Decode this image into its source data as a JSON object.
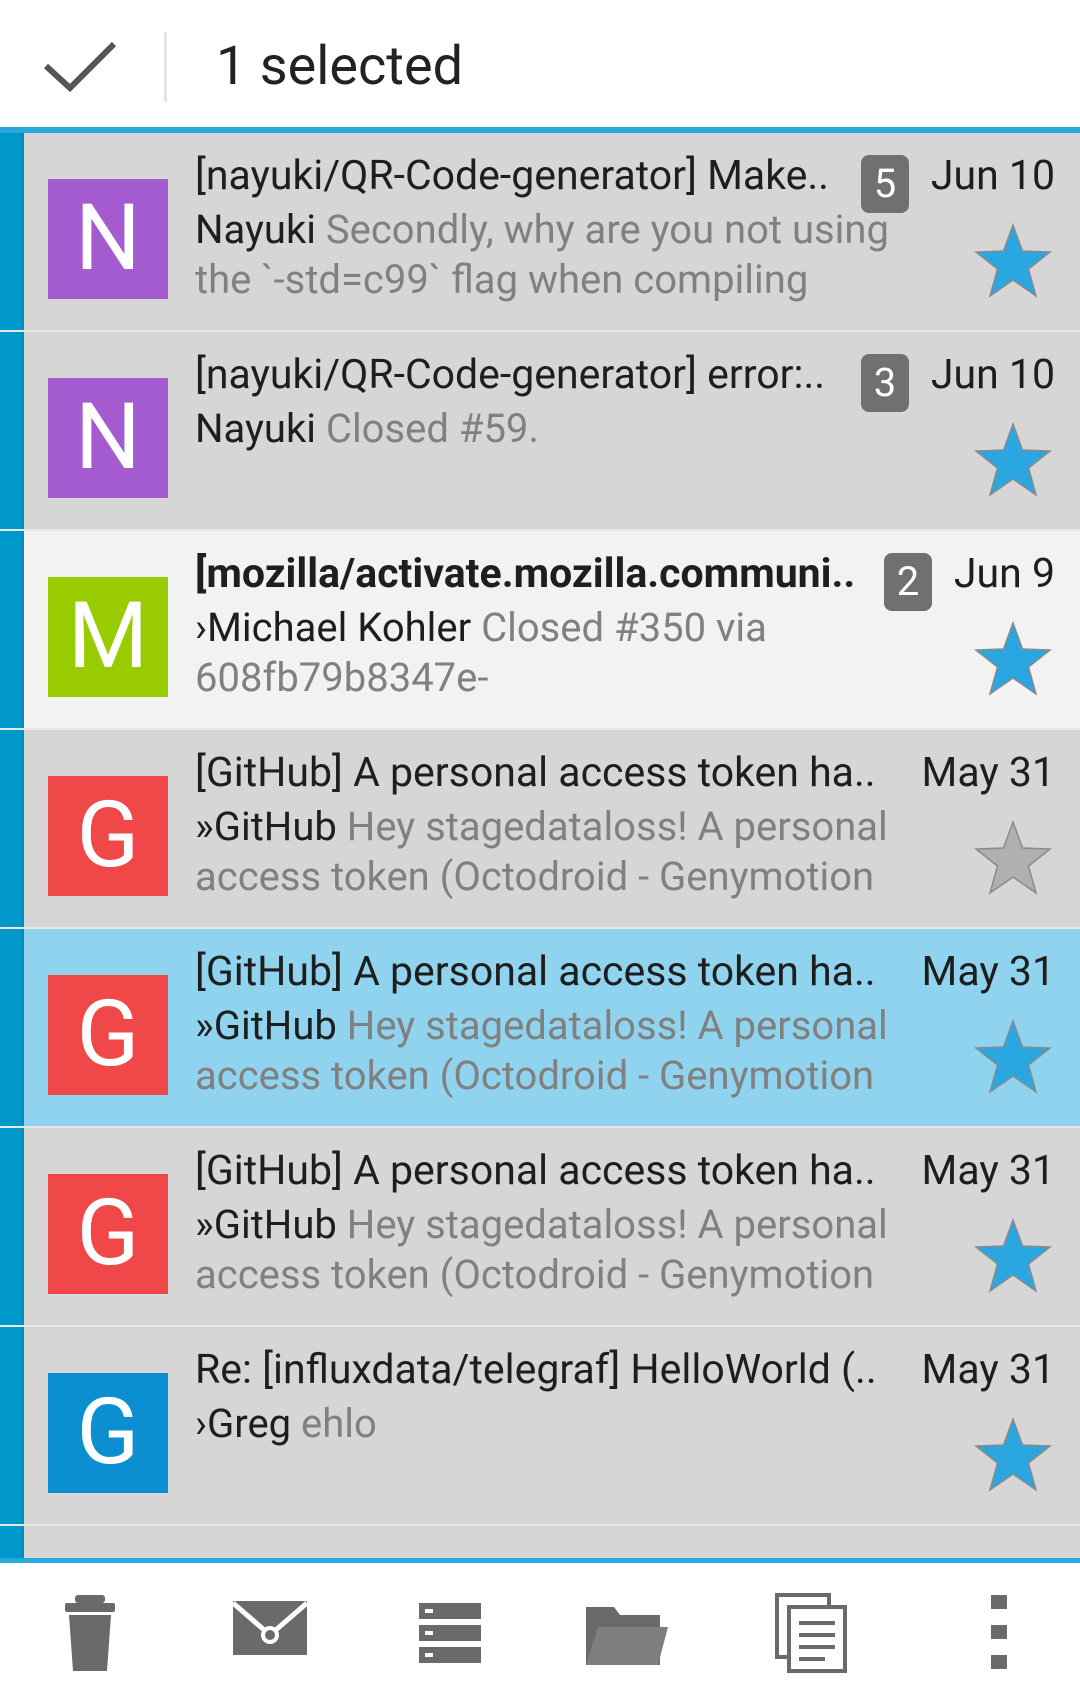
{
  "actionbar": {
    "selection_title": "1 selected",
    "icons": [
      "check-icon"
    ]
  },
  "colors": {
    "accent": "#29a8dc",
    "chip": "#0097c9",
    "row_default": "#d6d6d6",
    "row_read": "#f2f2f2",
    "row_selected": "#90d3ee",
    "star_active": "#2aa6e0",
    "star_inactive": "#b0b0b0"
  },
  "messages": [
    {
      "avatar_letter": "N",
      "avatar_color": "#a55bd0",
      "subject": "[nayuki/QR-Code-generator] Make..",
      "count": "5",
      "date": "Jun 10",
      "sender": "Nayuki",
      "preview": "Secondly, why are you not using the `-std=c99` flag when compiling",
      "starred": true,
      "bold": false,
      "state": "default"
    },
    {
      "avatar_letter": "N",
      "avatar_color": "#a55bd0",
      "subject": "[nayuki/QR-Code-generator] error:..",
      "count": "3",
      "date": "Jun 10",
      "sender": "Nayuki",
      "preview": "Closed #59.",
      "starred": true,
      "bold": false,
      "state": "default"
    },
    {
      "avatar_letter": "M",
      "avatar_color": "#99cc00",
      "subject": "[mozilla/activate.mozilla.communi..",
      "count": "2",
      "date": "Jun 9",
      "sender": "›Michael Kohler",
      "preview": "Closed #350 via 608fb79b8347e-",
      "starred": true,
      "bold": true,
      "state": "read"
    },
    {
      "avatar_letter": "G",
      "avatar_color": "#f04848",
      "subject": "[GitHub] A personal access token ha..",
      "count": "",
      "date": "May 31",
      "sender": "»GitHub",
      "preview": "Hey stagedataloss! A personal access token (Octodroid - Genymotion",
      "starred": false,
      "bold": false,
      "state": "default"
    },
    {
      "avatar_letter": "G",
      "avatar_color": "#f04848",
      "subject": "[GitHub] A personal access token ha..",
      "count": "",
      "date": "May 31",
      "sender": "»GitHub",
      "preview": "Hey stagedataloss! A personal access token (Octodroid - Genymotion",
      "starred": true,
      "bold": false,
      "state": "selected"
    },
    {
      "avatar_letter": "G",
      "avatar_color": "#f04848",
      "subject": "[GitHub] A personal access token ha..",
      "count": "",
      "date": "May 31",
      "sender": "»GitHub",
      "preview": "Hey stagedataloss! A personal access token (Octodroid - Genymotion",
      "starred": true,
      "bold": false,
      "state": "default"
    },
    {
      "avatar_letter": "G",
      "avatar_color": "#0b8fd0",
      "subject": "Re: [influxdata/telegraf] HelloWorld (..",
      "count": "",
      "date": "May 31",
      "sender": "›Greg",
      "preview": "ehlo",
      "starred": true,
      "bold": false,
      "state": "default"
    }
  ],
  "toolbar": {
    "icons": [
      "delete-icon",
      "mark-read-icon",
      "archive-icon",
      "move-folder-icon",
      "copy-icon",
      "overflow-menu-icon"
    ]
  }
}
